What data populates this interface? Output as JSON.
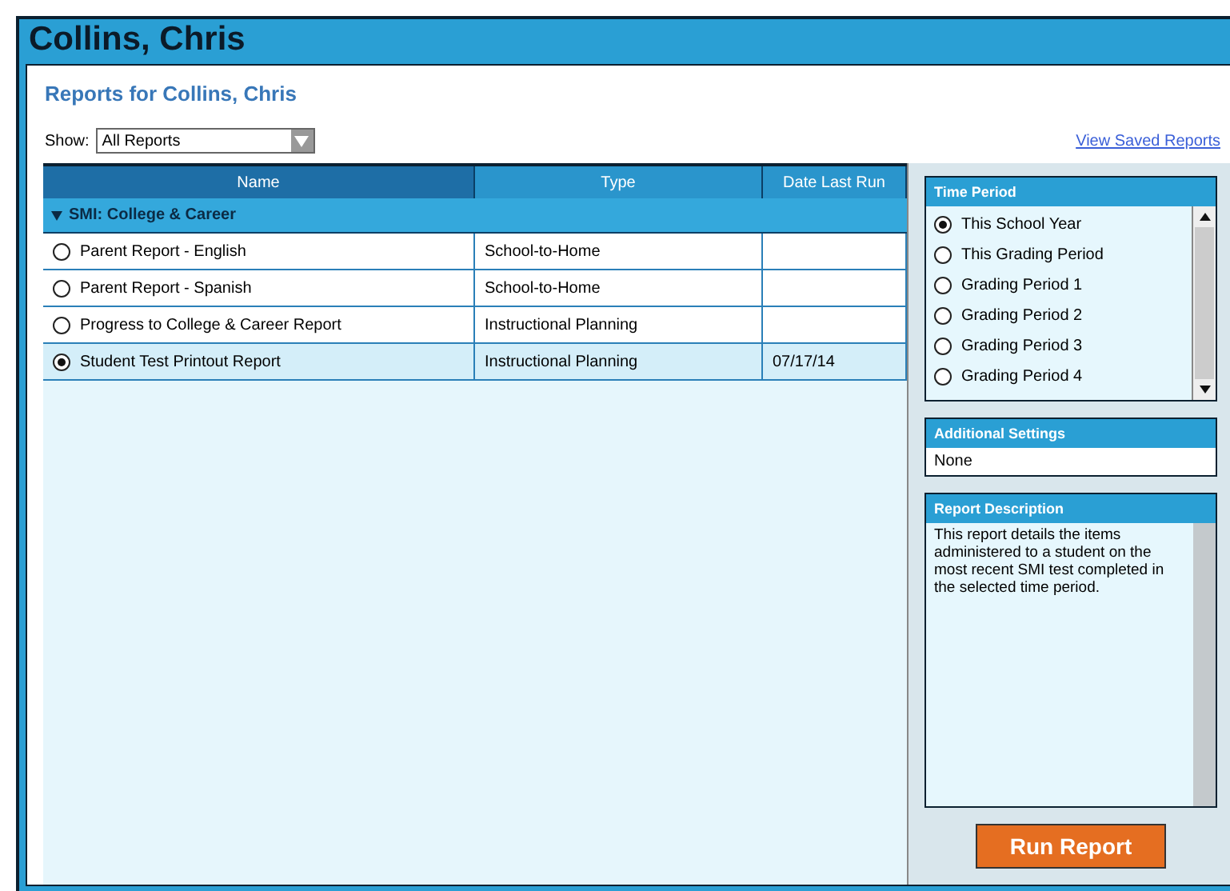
{
  "window": {
    "title": "Collins, Chris"
  },
  "heading": "Reports for Collins, Chris",
  "show": {
    "label": "Show:",
    "value": "All Reports"
  },
  "saved_link": "View Saved Reports",
  "table": {
    "columns": [
      "Name",
      "Type",
      "Date Last Run"
    ],
    "group": {
      "label": "SMI: College & Career",
      "expanded": true
    },
    "rows": [
      {
        "name": "Parent Report - English",
        "type": "School-to-Home",
        "date": "",
        "selected": false
      },
      {
        "name": "Parent Report - Spanish",
        "type": "School-to-Home",
        "date": "",
        "selected": false
      },
      {
        "name": "Progress to College & Career Report",
        "type": "Instructional Planning",
        "date": "",
        "selected": false
      },
      {
        "name": "Student Test Printout Report",
        "type": "Instructional Planning",
        "date": "07/17/14",
        "selected": true
      }
    ]
  },
  "time_period": {
    "title": "Time Period",
    "options": [
      {
        "label": "This School Year",
        "selected": true
      },
      {
        "label": "This Grading Period",
        "selected": false
      },
      {
        "label": "Grading Period 1",
        "selected": false
      },
      {
        "label": "Grading Period 2",
        "selected": false
      },
      {
        "label": "Grading Period 3",
        "selected": false
      },
      {
        "label": "Grading Period 4",
        "selected": false
      }
    ]
  },
  "additional_settings": {
    "title": "Additional Settings",
    "value": "None"
  },
  "report_description": {
    "title": "Report Description",
    "text": "This report details the items administered to a student on the most recent SMI test completed in the selected time period."
  },
  "run_button": "Run Report"
}
